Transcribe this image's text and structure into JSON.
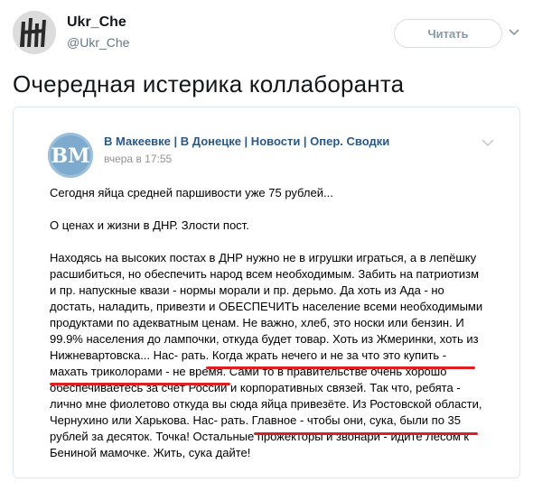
{
  "tweet": {
    "author_name": "Ukr_Che",
    "author_handle": "@Ukr_Che",
    "follow_label": "Читать",
    "text": "Очередная истерика коллаборанта"
  },
  "embed": {
    "group_name": "В Макеевке | В Донецке | Новости | Опер. Сводки",
    "posted": "вчера в 17:55",
    "avatar_text": "ВМ",
    "post_lines": [
      "Сегодня яйца средней паршивости уже 75 рублей...",
      "",
      "О ценах и жизни в ДНР. Злости пост.",
      "",
      "Находясь на высоких постах в ДНР нужно не в игрушки играться, а в лепёшку",
      "расшибиться, но обеспечить народ всем необходимым. Забить на патриотизм",
      "и пр. напускные квази - нормы морали и пр. дерьмо. Да хоть из Ада - но",
      "достать, наладить, привезти и ОБЕСПЕЧИТЬ население всеми необходимыми",
      "продуктами по адекватным ценам. Не важно, хлеб, это носки или бензин. И",
      "99.9% населения до лампочки, откуда будет товар. Хоть из Жмеринки, хоть из",
      "Нижневартовска... Нас- рать. Когда жрать нечего и не за что это купить -",
      "махать триколорами - не время. Сами то в правительстве очень хорошо",
      "обеспечиваетесь за счёт России и корпоративных связей. Так что, ребята -",
      "лично мне фиолетово откуда вы сюда яйца привезёте. Из Ростовской области,",
      "Чернухино или Харькова. Нас- рать. Главное - чтобы они, сука, были по 35",
      "рублей за десяток. Точка! Остальные прожекторы и звонари - идите Лесом к",
      "Бениной мамочке. Жить, сука дайте!"
    ]
  },
  "colors": {
    "vk_link": "#2a5885",
    "underline": "#e02020",
    "follow_border": "#d8dee3"
  }
}
